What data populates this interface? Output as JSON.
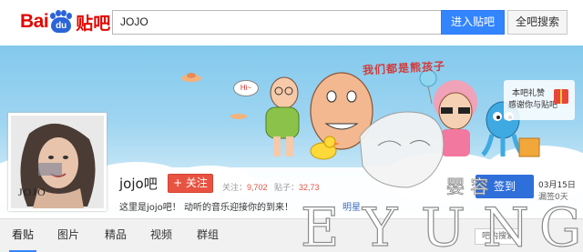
{
  "header": {
    "logo": {
      "bai": "Bai",
      "du": "du",
      "tieba": "贴吧"
    },
    "search_value": "JOJO",
    "enter_button": "进入贴吧",
    "all_search_button": "全吧搜索"
  },
  "banner": {
    "slogan": "我们都是熊孩子",
    "bubble_text": "Hi~",
    "gift_line1": "本吧礼赞",
    "gift_line2": "感谢你与贴吧"
  },
  "forum": {
    "avatar_label": "JOJO",
    "name": "jojo吧",
    "follow_button": "+ 关注",
    "followers_label": "关注：",
    "followers_value": "9,702",
    "posts_label": "贴子：",
    "posts_value": "32,73",
    "description": "这里是jojo吧！ 动听的音乐迎接你的到来！",
    "category": "明星",
    "signin_button": "签到",
    "date": "03月15日",
    "streak": "漏签0天"
  },
  "tabs": [
    {
      "label": "看贴",
      "active": true
    },
    {
      "label": "图片",
      "active": false
    },
    {
      "label": "精品",
      "active": false
    },
    {
      "label": "视频",
      "active": false
    },
    {
      "label": "群组",
      "active": false
    }
  ],
  "search_forum_button": "吧内搜索",
  "watermark": {
    "letters": "EYUNG",
    "chinese": "婴 容"
  },
  "colors": {
    "accent_blue": "#3385ff",
    "baidu_red": "#e10601",
    "follow_red": "#e85341",
    "signin_blue": "#2f6fda"
  }
}
